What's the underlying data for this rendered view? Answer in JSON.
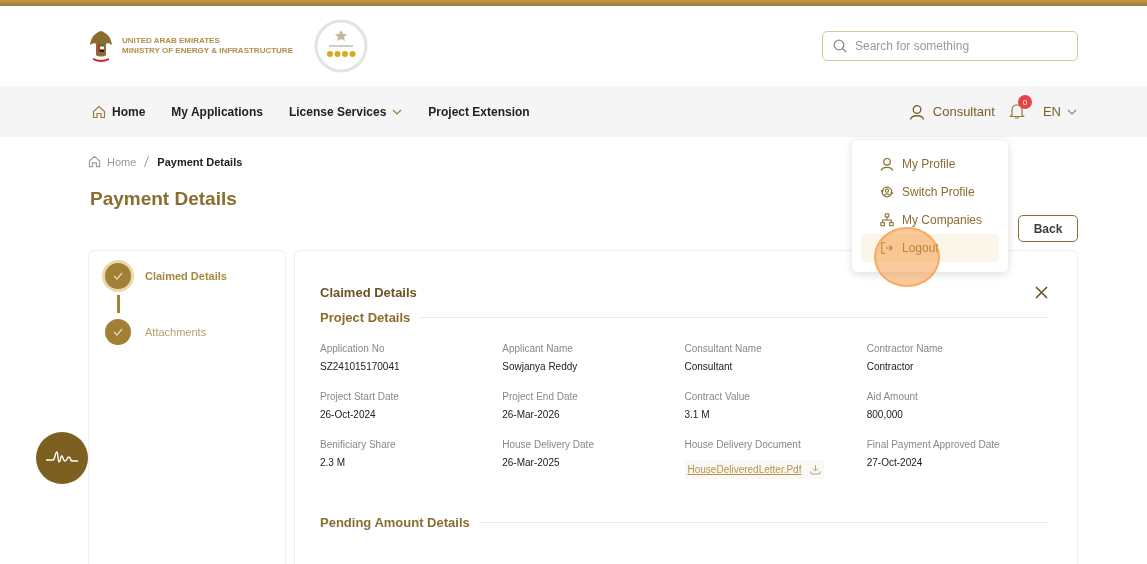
{
  "header": {
    "logo_line1": "UNITED ARAB EMIRATES",
    "logo_line2": "MINISTRY OF ENERGY & INFRASTRUCTURE",
    "search": {
      "placeholder": "Search for something"
    }
  },
  "nav": {
    "items": [
      {
        "label": "Home",
        "has_dropdown": false
      },
      {
        "label": "My Applications",
        "has_dropdown": false
      },
      {
        "label": "License Services",
        "has_dropdown": true
      },
      {
        "label": "Project Extension",
        "has_dropdown": false
      }
    ],
    "user": "Consultant",
    "notifications": "0",
    "language": "EN"
  },
  "user_menu": [
    {
      "label": "My Profile",
      "selected": false
    },
    {
      "label": "Switch Profile",
      "selected": false
    },
    {
      "label": "My Companies",
      "selected": false
    },
    {
      "label": "Logout",
      "selected": true
    }
  ],
  "breadcrumb": {
    "home": "Home",
    "current": "Payment Details"
  },
  "title": "Payment Details",
  "back_button": "Back",
  "steps": [
    {
      "label": "Claimed Details",
      "done": true,
      "selected": true
    },
    {
      "label": "Attachments",
      "done": true,
      "selected": false
    }
  ],
  "panel": {
    "title": "Claimed Details",
    "sections": [
      {
        "title": "Project Details",
        "fields": [
          {
            "label": "Application No",
            "value": "SZ241015170041",
            "kind": "text"
          },
          {
            "label": "Applicant Name",
            "value": "Sowjanya Reddy",
            "kind": "text"
          },
          {
            "label": "Consultant Name",
            "value": "Consultant",
            "kind": "text"
          },
          {
            "label": "Contractor Name",
            "value": "Contractor",
            "kind": "text"
          },
          {
            "label": "Project Start Date",
            "value": "26-Oct-2024",
            "kind": "text"
          },
          {
            "label": "Project End Date",
            "value": "26-Mar-2026",
            "kind": "text"
          },
          {
            "label": "Contract Value",
            "value": "3.1 M",
            "kind": "text"
          },
          {
            "label": "Aid Amount",
            "value": "800,000",
            "kind": "text"
          },
          {
            "label": "Benificiary Share",
            "value": "2.3 M",
            "kind": "text"
          },
          {
            "label": "House Delivery Date",
            "value": "26-Mar-2025",
            "kind": "text"
          },
          {
            "label": "House Delivery Document",
            "value": "HouseDeliveredLetter.Pdf",
            "kind": "file"
          },
          {
            "label": "Final Payment Approved Date",
            "value": "27-Oct-2024",
            "kind": "text"
          }
        ]
      },
      {
        "title": "Pending Amount Details"
      }
    ]
  }
}
